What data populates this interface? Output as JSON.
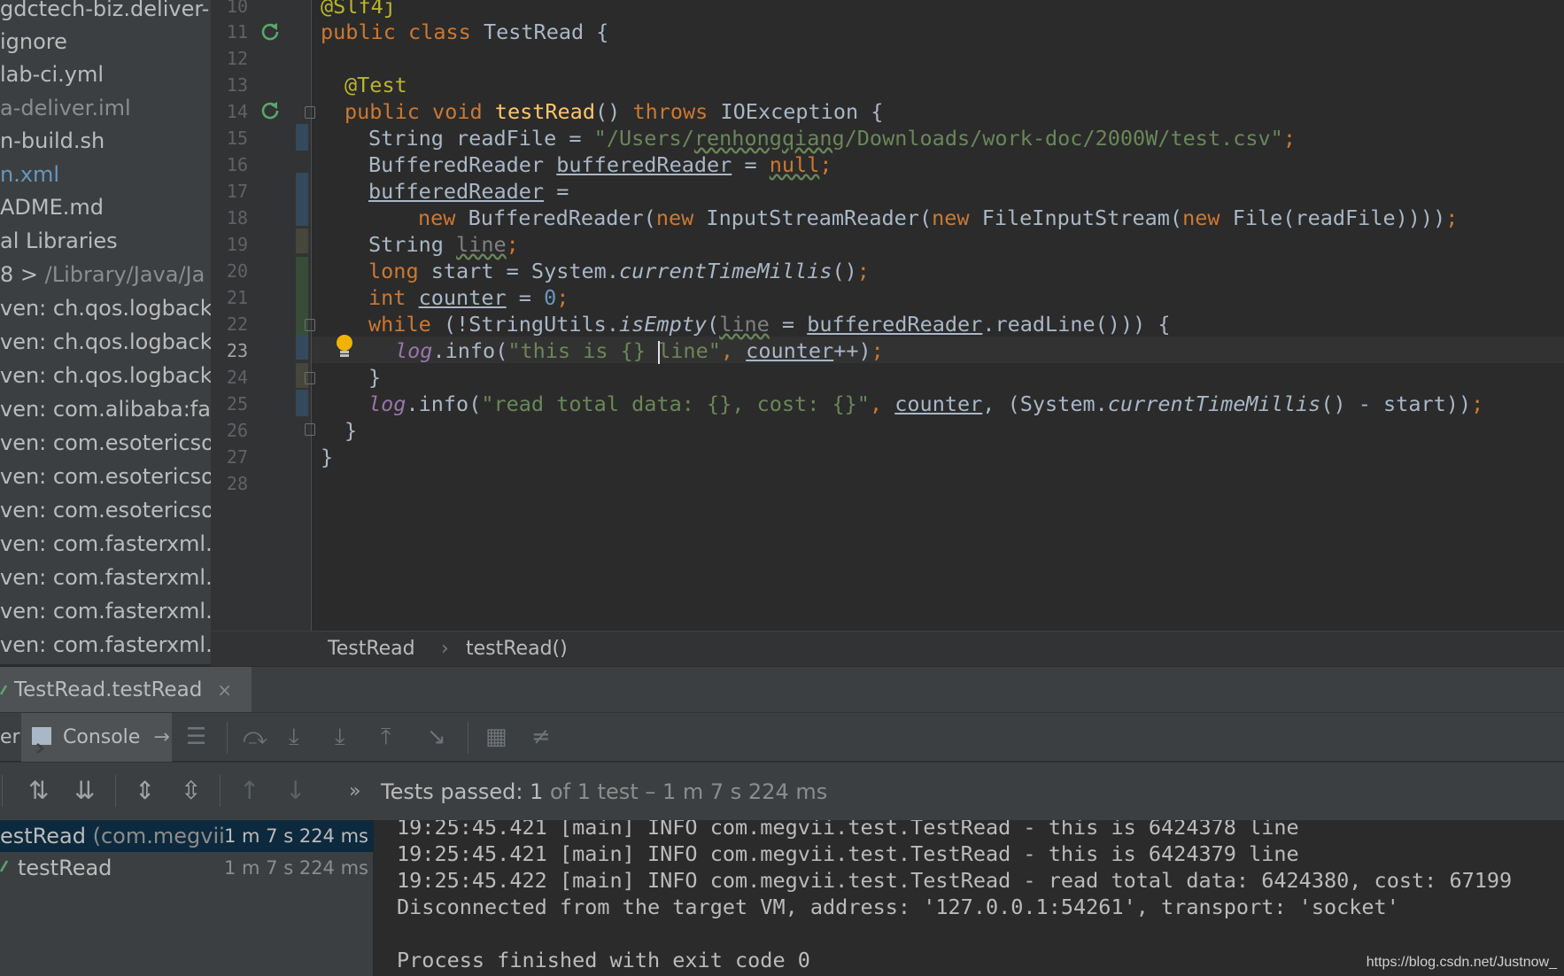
{
  "project_tree": [
    "gdctech-biz.deliver-",
    "ignore",
    "lab-ci.yml",
    "a-deliver.iml",
    "n-build.sh",
    "n.xml",
    "ADME.md",
    "al Libraries",
    "8 >",
    "/Library/Java/Ja",
    "ven: ch.qos.logback",
    "ven: ch.qos.logback",
    "ven: ch.qos.logback",
    "ven: com.alibaba:fas",
    "ven: com.esotericso",
    "ven: com.esotericso",
    "ven: com.esotericso",
    "ven: com.fasterxml.j",
    "ven: com.fasterxml.j",
    "ven: com.fasterxml.j",
    "ven: com.fasterxml.j"
  ],
  "line_numbers": [
    "10",
    "11",
    "12",
    "13",
    "14",
    "15",
    "16",
    "17",
    "18",
    "19",
    "20",
    "21",
    "22",
    "23",
    "24",
    "25",
    "26",
    "27",
    "28"
  ],
  "code": {
    "l10": "@Slf4j",
    "l11": [
      "public",
      "class",
      "TestRead {"
    ],
    "l13": "@Test",
    "l14": [
      "public",
      "void",
      "testRead",
      "()",
      "throws",
      "IOException {"
    ],
    "l15": [
      "String readFile = ",
      "\"/Users/",
      "renhongqiang",
      "/Downloads/work-doc/2000W/test.csv\"",
      ";"
    ],
    "l16": [
      "BufferedReader ",
      "bufferedReader",
      " = ",
      "null",
      ";"
    ],
    "l17": [
      "bufferedReader",
      " ="
    ],
    "l18": [
      "new",
      " BufferedReader(",
      "new",
      " InputStreamReader(",
      "new",
      " FileInputStream(",
      "new",
      " File(readFile))))",
      ";"
    ],
    "l19": [
      "String ",
      "line",
      ";"
    ],
    "l20": [
      "long",
      " start = System.",
      "currentTimeMillis",
      "()",
      ";"
    ],
    "l21": [
      "int",
      " ",
      "counter",
      " = ",
      "0",
      ";"
    ],
    "l22": [
      "while",
      " (!StringUtils.",
      "isEmpty",
      "(",
      "line",
      " = ",
      "bufferedReader",
      ".readLine())) {"
    ],
    "l23": [
      "log",
      ".info(",
      "\"this is {} ",
      "line\"",
      ", ",
      "counter",
      "++)",
      ";"
    ],
    "l24": "}",
    "l25": [
      "log",
      ".info(",
      "\"read total data: {}, cost: {}\"",
      ", ",
      "counter",
      ", (System.",
      "currentTimeMillis",
      "() - start))",
      ";"
    ],
    "l26": "}",
    "l27": "}"
  },
  "breadcrumb": {
    "class": "TestRead",
    "sep": "›",
    "method": "testRead()"
  },
  "run_tab": {
    "label": "TestRead.testRead",
    "close": "×"
  },
  "console_toolbar": {
    "left_label": "er",
    "console_label": "Console",
    "pin": "→"
  },
  "test_status": {
    "prefix": "Tests passed: ",
    "count": "1",
    "of": " of 1 test",
    "duration": " – 1 m 7 s 224 ms",
    "more": "»"
  },
  "test_tree": [
    {
      "name": "estRead",
      "pkg": " (com.megvii",
      "time": "1 m 7 s 224 ms"
    },
    {
      "name": "testRead",
      "pkg": "",
      "time": "1 m 7 s 224 ms"
    }
  ],
  "console_output": [
    "19:25:45.421 [main] INFO com.megvii.test.TestRead - this is 6424378 line",
    "19:25:45.421 [main] INFO com.megvii.test.TestRead - this is 6424379 line",
    "19:25:45.422 [main] INFO com.megvii.test.TestRead - read total data: 6424380, cost: 67199",
    "Disconnected from the target VM, address: '127.0.0.1:54261', transport: 'socket'",
    "",
    "Process finished with exit code 0"
  ],
  "watermark": "https://blog.csdn.net/Justnow_",
  "icons": [
    "run-gutter-icon",
    "fold-icon",
    "bulb-icon",
    "console-icon",
    "soft-wrap-icon",
    "scroll-end-icon",
    "download-icon",
    "upload-icon",
    "layout-icon",
    "sort-alpha-icon",
    "sort-duration-icon",
    "expand-all-icon",
    "collapse-all-icon",
    "prev-test-icon",
    "next-test-icon",
    "check-icon"
  ],
  "colors": {
    "keyword": "#cc7832",
    "string": "#6a8759",
    "number": "#6897bb",
    "annotation": "#bbb529",
    "method": "#ffc66d",
    "field": "#9876aa",
    "pass": "#59a869"
  }
}
